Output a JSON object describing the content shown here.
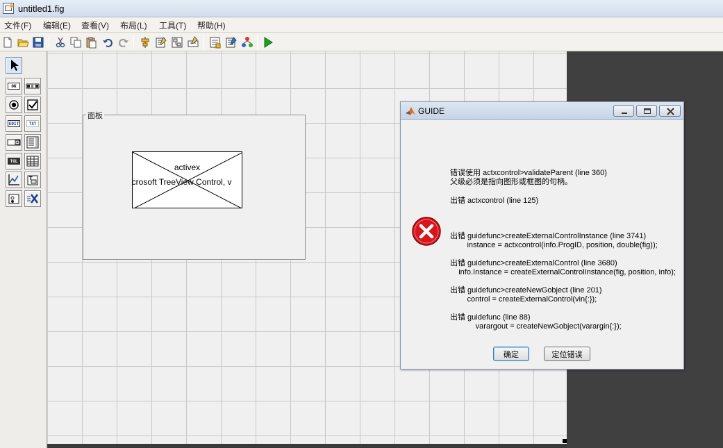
{
  "window": {
    "title": "untitled1.fig"
  },
  "menu": {
    "items": [
      "文件(F)",
      "编辑(E)",
      "查看(V)",
      "布局(L)",
      "工具(T)",
      "帮助(H)"
    ]
  },
  "toolbar": {
    "icons": [
      "new-file-icon",
      "open-folder-icon",
      "save-icon",
      "cut-icon",
      "copy-icon",
      "paste-icon",
      "undo-icon",
      "redo-icon",
      "align-objects-icon",
      "menu-editor-icon",
      "tab-order-icon",
      "toolbar-editor-icon",
      "m-file-editor-icon",
      "property-inspector-icon",
      "object-browser-icon",
      "run-icon"
    ]
  },
  "palette": {
    "labels": {
      "push_button": "OK",
      "edit_text": "EDIT",
      "static_text": "TXT",
      "toggle_button": "TGL"
    },
    "icons": [
      "select-arrow-icon",
      "push-button-icon",
      "slider-icon",
      "radio-button-icon",
      "checkbox-icon",
      "edit-text-icon",
      "static-text-icon",
      "popup-menu-icon",
      "listbox-icon",
      "toggle-button-icon",
      "table-icon",
      "axes-icon",
      "panel-icon",
      "button-group-icon",
      "activex-icon"
    ]
  },
  "panel": {
    "title": "面板",
    "activex": {
      "name": "activex",
      "progid": "Microsoft TreeView Control, v"
    }
  },
  "dialog": {
    "title": "GUIDE",
    "messages": [
      "错误使用 actxcontrol>validateParent (line 360)",
      "父级必须是指向图形或框图的句柄。",
      "出错 actxcontrol (line 125)",
      "出错 guidefunc>createExternalControlInstance (line 3741)",
      "        instance = actxcontrol(info.ProgID, position, double(fig));",
      "出错 guidefunc>createExternalControl (line 3680)",
      "    info.Instance = createExternalControlInstance(fig, position, info);",
      "出错 guidefunc>createNewGobject (line 201)",
      "        control = createExternalControl(vin{:});",
      "出错 guidefunc (line 88)",
      "            varargout = createNewGobject(varargin{:});"
    ],
    "buttons": {
      "ok": "确定",
      "locate": "定位错误"
    }
  },
  "colors": {
    "error_red": "#d8141c",
    "run_green": "#1aa31a",
    "dark_area": "#404040"
  }
}
